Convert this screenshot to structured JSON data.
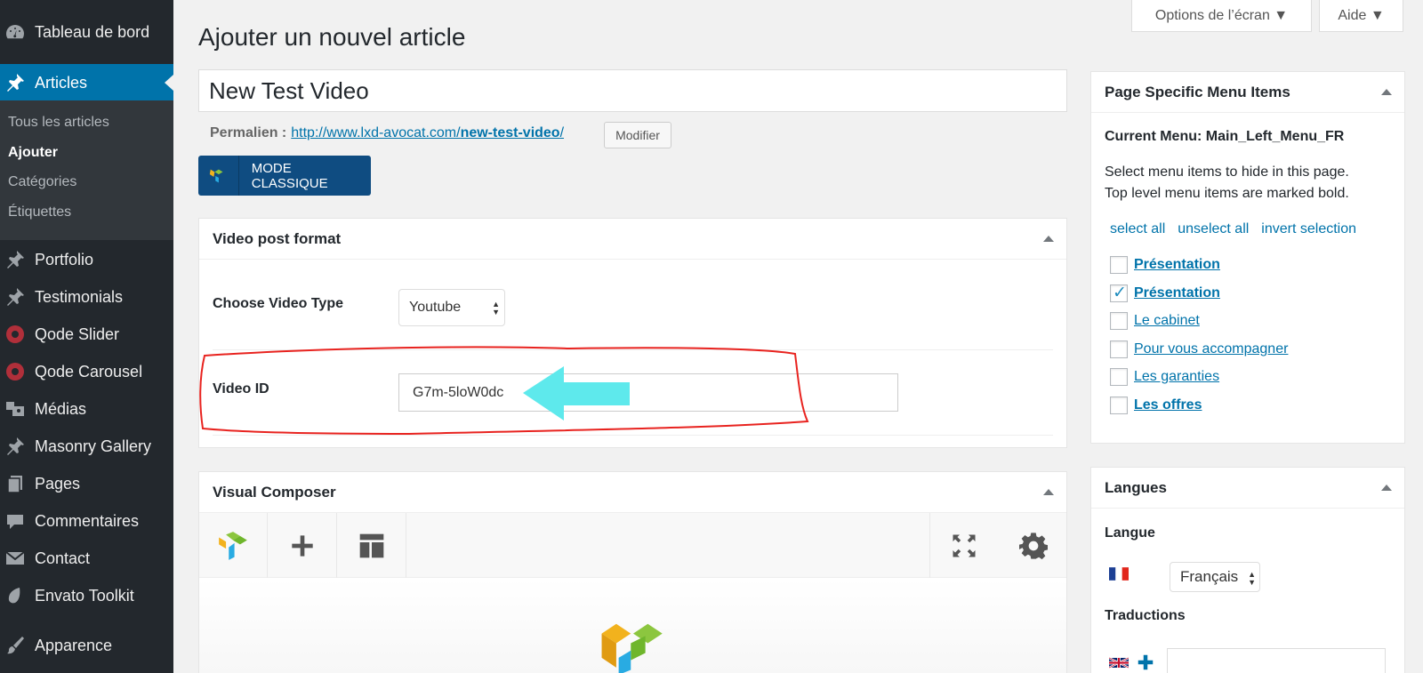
{
  "sidebar": {
    "dashboard": "Tableau de bord",
    "posts": "Articles",
    "submenu": [
      "Tous les articles",
      "Ajouter",
      "Catégories",
      "Étiquettes"
    ],
    "items": [
      "Portfolio",
      "Testimonials",
      "Qode Slider",
      "Qode Carousel",
      "Médias",
      "Masonry Gallery",
      "Pages",
      "Commentaires",
      "Contact",
      "Envato Toolkit",
      "Apparence"
    ]
  },
  "screen_options": "Options de l’écran ▼",
  "help": "Aide ▼",
  "page_title": "Ajouter un nouvel article",
  "post_title": "New Test Video",
  "permalink": {
    "label": "Permalien :",
    "base": "http://www.lxd-avocat.com/",
    "slug": "new-test-video",
    "trail": "/",
    "edit_button": "Modifier"
  },
  "classic_mode": "MODE CLASSIQUE",
  "video_post_format": {
    "title": "Video post format",
    "type_label": "Choose Video Type",
    "type_value": "Youtube",
    "id_label": "Video ID",
    "id_value": "G7m-5loW0dc"
  },
  "visual_composer": {
    "title": "Visual Composer"
  },
  "page_specific_menu": {
    "title": "Page Specific Menu Items",
    "current_menu": "Current Menu: Main_Left_Menu_FR",
    "instructions_1": "Select menu items to hide in this page.",
    "instructions_2": "Top level menu items are marked bold.",
    "select_all": "select all",
    "unselect_all": "unselect all",
    "invert_selection": "invert selection",
    "items": [
      {
        "label": "Présentation",
        "bold": true,
        "checked": false
      },
      {
        "label": "Présentation",
        "bold": true,
        "checked": true
      },
      {
        "label": "Le cabinet",
        "bold": false,
        "checked": false
      },
      {
        "label": "Pour vous accompagner",
        "bold": false,
        "checked": false
      },
      {
        "label": "Les garanties",
        "bold": false,
        "checked": false
      },
      {
        "label": "Les offres",
        "bold": true,
        "checked": false
      }
    ]
  },
  "langues": {
    "title": "Langues",
    "langue_label": "Langue",
    "langue_value": "Français",
    "translations_label": "Traductions"
  },
  "colors": {
    "sidebar_bg": "#23282d",
    "accent": "#0073aa",
    "annotation_red": "#e8231f",
    "annotation_cyan": "#5ee9ec"
  }
}
